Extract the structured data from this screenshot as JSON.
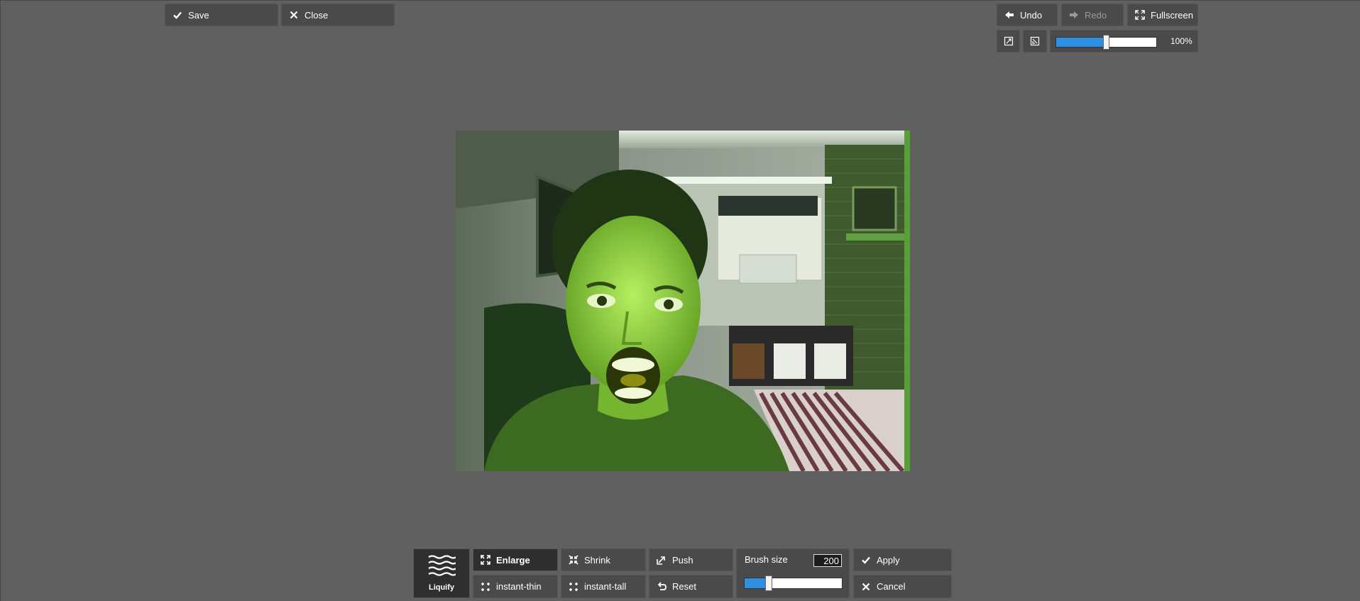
{
  "top_left": {
    "save_label": "Save",
    "close_label": "Close"
  },
  "top_right": {
    "undo_label": "Undo",
    "redo_label": "Redo",
    "fullscreen_label": "Fullscreen",
    "zoom_text": "100%",
    "zoom_fraction": 0.5
  },
  "canvas": {
    "description_icon": "photo-of-person"
  },
  "tools": {
    "liquify_label": "Liquify",
    "enlarge_label": "Enlarge",
    "shrink_label": "Shrink",
    "push_label": "Push",
    "instant_thin_label": "instant-thin",
    "instant_tall_label": "instant-tall",
    "reset_label": "Reset",
    "brush_size_label": "Brush size",
    "brush_size_value": "200",
    "brush_fraction": 0.25,
    "apply_label": "Apply",
    "cancel_label": "Cancel"
  },
  "colors": {
    "background": "#606060",
    "button": "#4a4a4a",
    "accent": "#2f8fe0"
  }
}
